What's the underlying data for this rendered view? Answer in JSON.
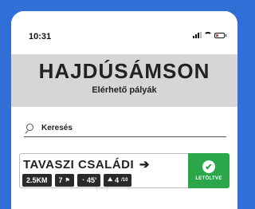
{
  "status_bar": {
    "time": "10:31"
  },
  "header": {
    "title": "HAJDÚSÁMSON",
    "subtitle": "Elérhető pályák"
  },
  "search": {
    "placeholder": "Keresés"
  },
  "routes": [
    {
      "name": "TAVASZI CSALÁDI",
      "arrow": "➔",
      "distance": "2.5KM",
      "checkpoints": "7",
      "flag_icon": "⚑",
      "duration": "45'",
      "clock_icon": "◔",
      "difficulty": "4",
      "difficulty_max": "/10",
      "difficulty_icon": "⛰",
      "download_label": "LETÖLTVE",
      "download_icon": "✔"
    }
  ],
  "colors": {
    "background": "#2f6fd6",
    "header_bg": "#d6d6d6",
    "tag_bg": "#2a2a2a",
    "downloaded_green": "#2ba64a"
  }
}
